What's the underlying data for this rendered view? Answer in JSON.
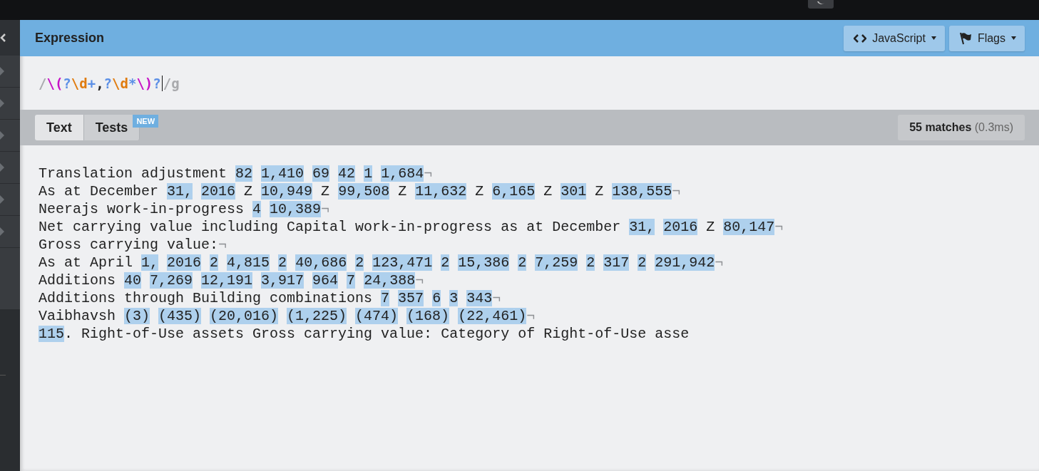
{
  "expression": {
    "title": "Expression",
    "buttons": [
      {
        "kind": "code",
        "label": "JavaScript"
      },
      {
        "kind": "flag",
        "label": "Flags"
      }
    ],
    "tokens": [
      {
        "kind": "delimiter",
        "text": "/"
      },
      {
        "kind": "group",
        "text": "\\("
      },
      {
        "kind": "quantifier",
        "text": "?"
      },
      {
        "kind": "class",
        "text": "\\d"
      },
      {
        "kind": "quantifier",
        "text": "+"
      },
      {
        "kind": "literal",
        "text": ","
      },
      {
        "kind": "quantifier",
        "text": "?"
      },
      {
        "kind": "class",
        "text": "\\d"
      },
      {
        "kind": "quantifier",
        "text": "*"
      },
      {
        "kind": "group",
        "text": "\\)"
      },
      {
        "kind": "quantifier",
        "text": "?"
      },
      {
        "kind": "delimiter",
        "text": "/g"
      }
    ]
  },
  "tabs": [
    {
      "label": "Text",
      "selected": true
    },
    {
      "label": "Tests",
      "selected": false,
      "badge": "NEW"
    }
  ],
  "matches": {
    "count": "55 matches",
    "time": "(0.3ms)"
  },
  "lines": [
    {
      "eol": "¬",
      "tokens": [
        {
          "text": "Translation adjustment",
          "match": false
        },
        {
          "text": "82",
          "match": true
        },
        {
          "text": "1,410",
          "match": true
        },
        {
          "text": "69",
          "match": true
        },
        {
          "text": "42",
          "match": true
        },
        {
          "text": "1",
          "match": true
        },
        {
          "text": "1,684",
          "match": true
        }
      ]
    },
    {
      "eol": "¬",
      "tokens": [
        {
          "text": "As at December",
          "match": false
        },
        {
          "text": "31,",
          "match": true
        },
        {
          "text": "2016",
          "match": true
        },
        {
          "text": "Z",
          "match": false
        },
        {
          "text": "10,949",
          "match": true
        },
        {
          "text": "Z",
          "match": false
        },
        {
          "text": "99,508",
          "match": true
        },
        {
          "text": "Z",
          "match": false
        },
        {
          "text": "11,632",
          "match": true
        },
        {
          "text": "Z",
          "match": false
        },
        {
          "text": "6,165",
          "match": true
        },
        {
          "text": "Z",
          "match": false
        },
        {
          "text": "301",
          "match": true
        },
        {
          "text": "Z",
          "match": false
        },
        {
          "text": "138,555",
          "match": true
        }
      ]
    },
    {
      "eol": "¬",
      "tokens": [
        {
          "text": "Neerajs work-in-progress",
          "match": false
        },
        {
          "text": "4",
          "match": true
        },
        {
          "text": "10,389",
          "match": true
        }
      ]
    },
    {
      "eol": "¬",
      "tokens": [
        {
          "text": "Net carrying value including Capital work-in-progress as at December",
          "match": false
        },
        {
          "text": "31,",
          "match": true
        },
        {
          "text": "2016",
          "match": true
        },
        {
          "text": "Z",
          "match": false
        },
        {
          "text": "80,147",
          "match": true
        }
      ]
    },
    {
      "eol": "¬",
      "tokens": [
        {
          "text": "Gross carrying value:",
          "match": false
        }
      ]
    },
    {
      "eol": "¬",
      "tokens": [
        {
          "text": "As at April",
          "match": false
        },
        {
          "text": "1,",
          "match": true
        },
        {
          "text": "2016",
          "match": true
        },
        {
          "text": "2",
          "match": true
        },
        {
          "text": "4,815",
          "match": true
        },
        {
          "text": "2",
          "match": true
        },
        {
          "text": "40,686",
          "match": true
        },
        {
          "text": "2",
          "match": true
        },
        {
          "text": "123,471",
          "match": true
        },
        {
          "text": "2",
          "match": true
        },
        {
          "text": "15,386",
          "match": true
        },
        {
          "text": "2",
          "match": true
        },
        {
          "text": "7,259",
          "match": true
        },
        {
          "text": "2",
          "match": true
        },
        {
          "text": "317",
          "match": true
        },
        {
          "text": "2",
          "match": true
        },
        {
          "text": "291,942",
          "match": true
        }
      ]
    },
    {
      "eol": "¬",
      "tokens": [
        {
          "text": "Additions",
          "match": false
        },
        {
          "text": "40",
          "match": true
        },
        {
          "text": "7,269",
          "match": true
        },
        {
          "text": "12,191",
          "match": true
        },
        {
          "text": "3,917",
          "match": true
        },
        {
          "text": "964",
          "match": true
        },
        {
          "text": "7",
          "match": true
        },
        {
          "text": "24,388",
          "match": true
        }
      ]
    },
    {
      "eol": "¬",
      "tokens": [
        {
          "text": "Additions through Building combinations",
          "match": false
        },
        {
          "text": "7",
          "match": true
        },
        {
          "text": "357",
          "match": true
        },
        {
          "text": "6",
          "match": true
        },
        {
          "text": "3",
          "match": true
        },
        {
          "text": "343",
          "match": true
        }
      ]
    },
    {
      "eol": "¬",
      "tokens": [
        {
          "text": "Vaibhavsh",
          "match": false
        },
        {
          "text": "(3)",
          "match": true
        },
        {
          "text": "(435)",
          "match": true
        },
        {
          "text": "(20,016)",
          "match": true
        },
        {
          "text": "(1,225)",
          "match": true
        },
        {
          "text": "(474)",
          "match": true
        },
        {
          "text": "(168)",
          "match": true
        },
        {
          "text": "(22,461)",
          "match": true
        }
      ]
    },
    {
      "tokens": [
        {
          "text": "115",
          "match": true
        },
        {
          "text": ".",
          "match": false,
          "glue": true
        },
        {
          "text": "Right-of-Use assets Gross carrying value: Category of Right-of-Use asse",
          "match": false
        }
      ]
    }
  ]
}
